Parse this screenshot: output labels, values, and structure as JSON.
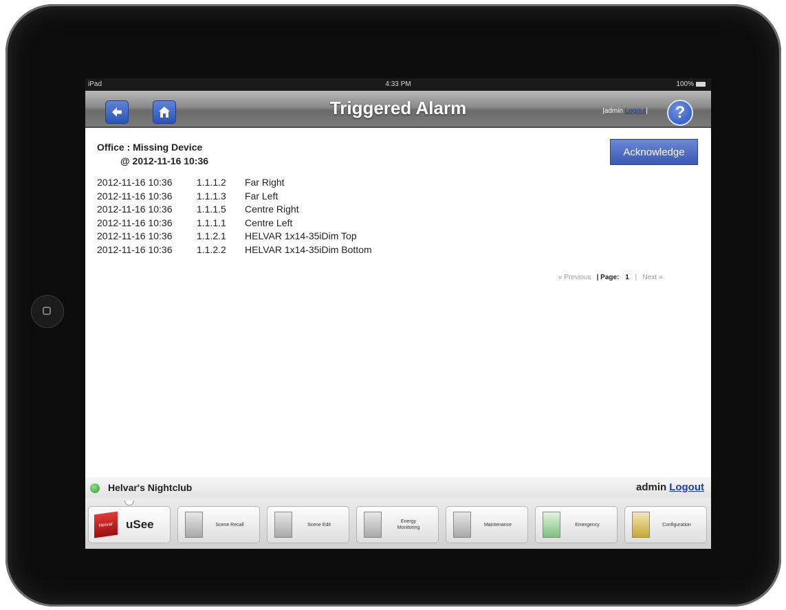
{
  "status_bar": {
    "carrier": "iPad",
    "time": "4:33 PM",
    "battery": "100%"
  },
  "header": {
    "title": "Triggered Alarm",
    "user": "admin",
    "logout": "Logout",
    "help": "?"
  },
  "alarm": {
    "title": "Office : Missing Device",
    "time": "@ 2012-11-16 10:36",
    "acknowledge_label": "Acknowledge"
  },
  "devices": [
    {
      "time": "2012-11-16 10:36",
      "address": "1.1.1.2",
      "name": "Far Right"
    },
    {
      "time": "2012-11-16 10:36",
      "address": "1.1.1.3",
      "name": "Far Left"
    },
    {
      "time": "2012-11-16 10:36",
      "address": "1.1.1.5",
      "name": "Centre Right"
    },
    {
      "time": "2012-11-16 10:36",
      "address": "1.1.1.1",
      "name": "Centre Left"
    },
    {
      "time": "2012-11-16 10:36",
      "address": "1.1.2.1",
      "name": "HELVAR 1x14-35iDim Top"
    },
    {
      "time": "2012-11-16 10:36",
      "address": "1.1.2.2",
      "name": "HELVAR 1x14-35iDim Bottom"
    }
  ],
  "pager": {
    "previous": "« Previous",
    "page_label": "| Page:",
    "page": "1",
    "sep": "|",
    "next": "Next »"
  },
  "site": {
    "name": "Helvar's Nightclub",
    "user": "admin",
    "logout": "Logout"
  },
  "tabs": {
    "usee_logo": "Helvar",
    "usee_label": "uSee",
    "scene_recall": "Scene Recall",
    "scene_edit": "Scene Edit",
    "energy_line1": "Energy",
    "energy_line2": "Monitoring",
    "maintenance": "Maintenance",
    "emergency": "Emergency",
    "configuration": "Configuration"
  },
  "colors": {
    "accent": "#2b56b8",
    "header": "#7a7a7a",
    "status_ok": "#2f9b2b"
  },
  "icons": [
    "back-arrow-icon",
    "home-icon",
    "help-icon",
    "status-dot-icon"
  ]
}
